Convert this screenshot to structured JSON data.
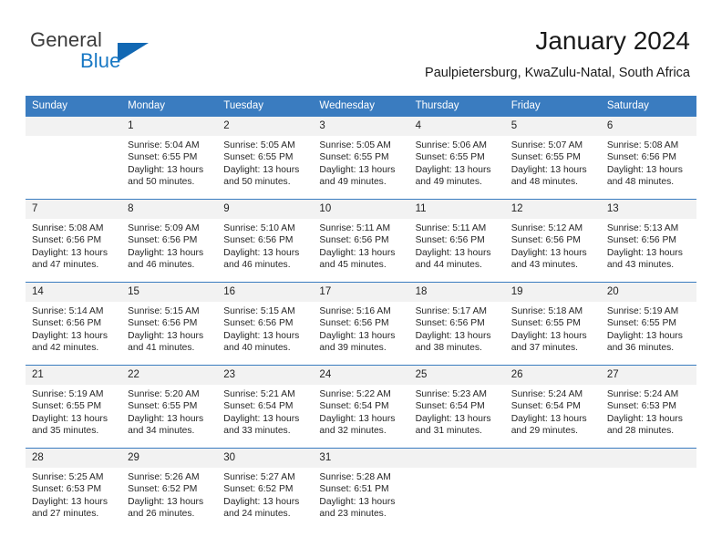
{
  "brand": {
    "name_part1": "General",
    "name_part2": "Blue",
    "accent_color": "#1268b3"
  },
  "header": {
    "title": "January 2024",
    "location": "Paulpietersburg, KwaZulu-Natal, South Africa"
  },
  "theme": {
    "header_row_color": "#3a7cc0",
    "daynum_band_color": "#f2f2f2",
    "text_color": "#262626"
  },
  "weekday_headers": [
    "Sunday",
    "Monday",
    "Tuesday",
    "Wednesday",
    "Thursday",
    "Friday",
    "Saturday"
  ],
  "weeks": [
    [
      {
        "day": "",
        "sunrise": "",
        "sunset": "",
        "daylight_a": "",
        "daylight_b": "",
        "blank": true
      },
      {
        "day": "1",
        "sunrise": "Sunrise: 5:04 AM",
        "sunset": "Sunset: 6:55 PM",
        "daylight_a": "Daylight: 13 hours",
        "daylight_b": "and 50 minutes."
      },
      {
        "day": "2",
        "sunrise": "Sunrise: 5:05 AM",
        "sunset": "Sunset: 6:55 PM",
        "daylight_a": "Daylight: 13 hours",
        "daylight_b": "and 50 minutes."
      },
      {
        "day": "3",
        "sunrise": "Sunrise: 5:05 AM",
        "sunset": "Sunset: 6:55 PM",
        "daylight_a": "Daylight: 13 hours",
        "daylight_b": "and 49 minutes."
      },
      {
        "day": "4",
        "sunrise": "Sunrise: 5:06 AM",
        "sunset": "Sunset: 6:55 PM",
        "daylight_a": "Daylight: 13 hours",
        "daylight_b": "and 49 minutes."
      },
      {
        "day": "5",
        "sunrise": "Sunrise: 5:07 AM",
        "sunset": "Sunset: 6:55 PM",
        "daylight_a": "Daylight: 13 hours",
        "daylight_b": "and 48 minutes."
      },
      {
        "day": "6",
        "sunrise": "Sunrise: 5:08 AM",
        "sunset": "Sunset: 6:56 PM",
        "daylight_a": "Daylight: 13 hours",
        "daylight_b": "and 48 minutes."
      }
    ],
    [
      {
        "day": "7",
        "sunrise": "Sunrise: 5:08 AM",
        "sunset": "Sunset: 6:56 PM",
        "daylight_a": "Daylight: 13 hours",
        "daylight_b": "and 47 minutes."
      },
      {
        "day": "8",
        "sunrise": "Sunrise: 5:09 AM",
        "sunset": "Sunset: 6:56 PM",
        "daylight_a": "Daylight: 13 hours",
        "daylight_b": "and 46 minutes."
      },
      {
        "day": "9",
        "sunrise": "Sunrise: 5:10 AM",
        "sunset": "Sunset: 6:56 PM",
        "daylight_a": "Daylight: 13 hours",
        "daylight_b": "and 46 minutes."
      },
      {
        "day": "10",
        "sunrise": "Sunrise: 5:11 AM",
        "sunset": "Sunset: 6:56 PM",
        "daylight_a": "Daylight: 13 hours",
        "daylight_b": "and 45 minutes."
      },
      {
        "day": "11",
        "sunrise": "Sunrise: 5:11 AM",
        "sunset": "Sunset: 6:56 PM",
        "daylight_a": "Daylight: 13 hours",
        "daylight_b": "and 44 minutes."
      },
      {
        "day": "12",
        "sunrise": "Sunrise: 5:12 AM",
        "sunset": "Sunset: 6:56 PM",
        "daylight_a": "Daylight: 13 hours",
        "daylight_b": "and 43 minutes."
      },
      {
        "day": "13",
        "sunrise": "Sunrise: 5:13 AM",
        "sunset": "Sunset: 6:56 PM",
        "daylight_a": "Daylight: 13 hours",
        "daylight_b": "and 43 minutes."
      }
    ],
    [
      {
        "day": "14",
        "sunrise": "Sunrise: 5:14 AM",
        "sunset": "Sunset: 6:56 PM",
        "daylight_a": "Daylight: 13 hours",
        "daylight_b": "and 42 minutes."
      },
      {
        "day": "15",
        "sunrise": "Sunrise: 5:15 AM",
        "sunset": "Sunset: 6:56 PM",
        "daylight_a": "Daylight: 13 hours",
        "daylight_b": "and 41 minutes."
      },
      {
        "day": "16",
        "sunrise": "Sunrise: 5:15 AM",
        "sunset": "Sunset: 6:56 PM",
        "daylight_a": "Daylight: 13 hours",
        "daylight_b": "and 40 minutes."
      },
      {
        "day": "17",
        "sunrise": "Sunrise: 5:16 AM",
        "sunset": "Sunset: 6:56 PM",
        "daylight_a": "Daylight: 13 hours",
        "daylight_b": "and 39 minutes."
      },
      {
        "day": "18",
        "sunrise": "Sunrise: 5:17 AM",
        "sunset": "Sunset: 6:56 PM",
        "daylight_a": "Daylight: 13 hours",
        "daylight_b": "and 38 minutes."
      },
      {
        "day": "19",
        "sunrise": "Sunrise: 5:18 AM",
        "sunset": "Sunset: 6:55 PM",
        "daylight_a": "Daylight: 13 hours",
        "daylight_b": "and 37 minutes."
      },
      {
        "day": "20",
        "sunrise": "Sunrise: 5:19 AM",
        "sunset": "Sunset: 6:55 PM",
        "daylight_a": "Daylight: 13 hours",
        "daylight_b": "and 36 minutes."
      }
    ],
    [
      {
        "day": "21",
        "sunrise": "Sunrise: 5:19 AM",
        "sunset": "Sunset: 6:55 PM",
        "daylight_a": "Daylight: 13 hours",
        "daylight_b": "and 35 minutes."
      },
      {
        "day": "22",
        "sunrise": "Sunrise: 5:20 AM",
        "sunset": "Sunset: 6:55 PM",
        "daylight_a": "Daylight: 13 hours",
        "daylight_b": "and 34 minutes."
      },
      {
        "day": "23",
        "sunrise": "Sunrise: 5:21 AM",
        "sunset": "Sunset: 6:54 PM",
        "daylight_a": "Daylight: 13 hours",
        "daylight_b": "and 33 minutes."
      },
      {
        "day": "24",
        "sunrise": "Sunrise: 5:22 AM",
        "sunset": "Sunset: 6:54 PM",
        "daylight_a": "Daylight: 13 hours",
        "daylight_b": "and 32 minutes."
      },
      {
        "day": "25",
        "sunrise": "Sunrise: 5:23 AM",
        "sunset": "Sunset: 6:54 PM",
        "daylight_a": "Daylight: 13 hours",
        "daylight_b": "and 31 minutes."
      },
      {
        "day": "26",
        "sunrise": "Sunrise: 5:24 AM",
        "sunset": "Sunset: 6:54 PM",
        "daylight_a": "Daylight: 13 hours",
        "daylight_b": "and 29 minutes."
      },
      {
        "day": "27",
        "sunrise": "Sunrise: 5:24 AM",
        "sunset": "Sunset: 6:53 PM",
        "daylight_a": "Daylight: 13 hours",
        "daylight_b": "and 28 minutes."
      }
    ],
    [
      {
        "day": "28",
        "sunrise": "Sunrise: 5:25 AM",
        "sunset": "Sunset: 6:53 PM",
        "daylight_a": "Daylight: 13 hours",
        "daylight_b": "and 27 minutes."
      },
      {
        "day": "29",
        "sunrise": "Sunrise: 5:26 AM",
        "sunset": "Sunset: 6:52 PM",
        "daylight_a": "Daylight: 13 hours",
        "daylight_b": "and 26 minutes."
      },
      {
        "day": "30",
        "sunrise": "Sunrise: 5:27 AM",
        "sunset": "Sunset: 6:52 PM",
        "daylight_a": "Daylight: 13 hours",
        "daylight_b": "and 24 minutes."
      },
      {
        "day": "31",
        "sunrise": "Sunrise: 5:28 AM",
        "sunset": "Sunset: 6:51 PM",
        "daylight_a": "Daylight: 13 hours",
        "daylight_b": "and 23 minutes."
      },
      {
        "day": "",
        "sunrise": "",
        "sunset": "",
        "daylight_a": "",
        "daylight_b": "",
        "blank": true
      },
      {
        "day": "",
        "sunrise": "",
        "sunset": "",
        "daylight_a": "",
        "daylight_b": "",
        "blank": true
      },
      {
        "day": "",
        "sunrise": "",
        "sunset": "",
        "daylight_a": "",
        "daylight_b": "",
        "blank": true
      }
    ]
  ]
}
